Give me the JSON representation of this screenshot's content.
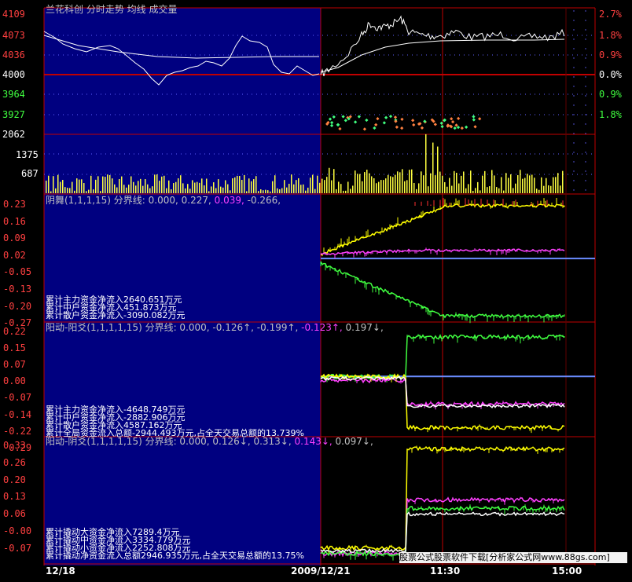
{
  "header": {
    "title": "兰花科创  分时走势  均线  成交量"
  },
  "price_panel": {
    "left_ticks": [
      "4109",
      "4073",
      "4036",
      "4000",
      "3964",
      "3927"
    ],
    "right_ticks": [
      "2.7%",
      "1.8%",
      "0.9%",
      "0.0%",
      "0.9%",
      "1.8%"
    ],
    "tick_colors": [
      "#ff4040",
      "#ff4040",
      "#ff4040",
      "#ffffff",
      "#40ff40",
      "#40ff40"
    ]
  },
  "volume_panel": {
    "ticks": [
      "2062",
      "1375",
      "687"
    ]
  },
  "indicator1": {
    "title_prefix": "阴舞(1,1,1,15)  分界线: 0.000, 0.227, ",
    "title_v3": "0.039,",
    "title_suffix": " -0.266,",
    "ticks": [
      "0.23",
      "0.16",
      "0.09",
      "0.02",
      "-0.05",
      "-0.13",
      "-0.20",
      "-0.27"
    ],
    "summary": [
      "累计主力资金净流入2640.651万元",
      "累计中户资金净流入451.873万元",
      "累计散户资金净流入-3090.082万元"
    ]
  },
  "indicator2": {
    "title_prefix": "阳动-阳爻(1,1,1,1,15)  分界线: 0.000, -0.126",
    "title_mid": "↑, -0.199↑, ",
    "title_v4": "-0.123↑,",
    "title_suffix": " 0.197↓,",
    "ticks": [
      "0.22",
      "0.15",
      "0.07",
      "0.00",
      "-0.07",
      "-0.14",
      "-0.22",
      "-0.29"
    ],
    "summary": [
      "累计主力资金净流入-4648.749万元",
      "累计中户资金净流入-2882.906万元",
      "累计散户资金净流入4587.162万元",
      "累计全局资金流入总额-2944.493万元,占全天交易总额的13.739%"
    ]
  },
  "indicator3": {
    "title_prefix": "阳动-阴爻(1,1,1,1,15)  分界线: 0.000, 0.126↓, 0.313↓, ",
    "title_v4": "0.143↓,",
    "title_suffix": " 0.097↓,",
    "ticks": [
      "0.33",
      "0.26",
      "0.20",
      "0.13",
      "0.06",
      "-0.00",
      "-0.07"
    ],
    "summary": [
      "累计撬动大资金净流入7289.4万元",
      "累计撬动中资金净流入3334.779万元",
      "累计撬动小资金净流入2252.808万元",
      "累计撬动净资金流入总额2946.935万元,占全天交易总额的13.75%"
    ]
  },
  "time_axis": {
    "left_date": "12/18",
    "mid_date": "2009/12/21",
    "t1": "11:30",
    "t2": "15:00"
  },
  "watermark": "股票公式股票软件下载[分析家公式网www.88gs.com]",
  "colors": {
    "blue_bg": "#000080",
    "grid_red": "#c00000",
    "price_line": "#ffffff",
    "volume": "#ffff40",
    "main_flow": "#ffff00",
    "mid_flow": "#ff40ff",
    "retail_flow": "#40ff40",
    "zero_line": "#6a8cff"
  }
}
